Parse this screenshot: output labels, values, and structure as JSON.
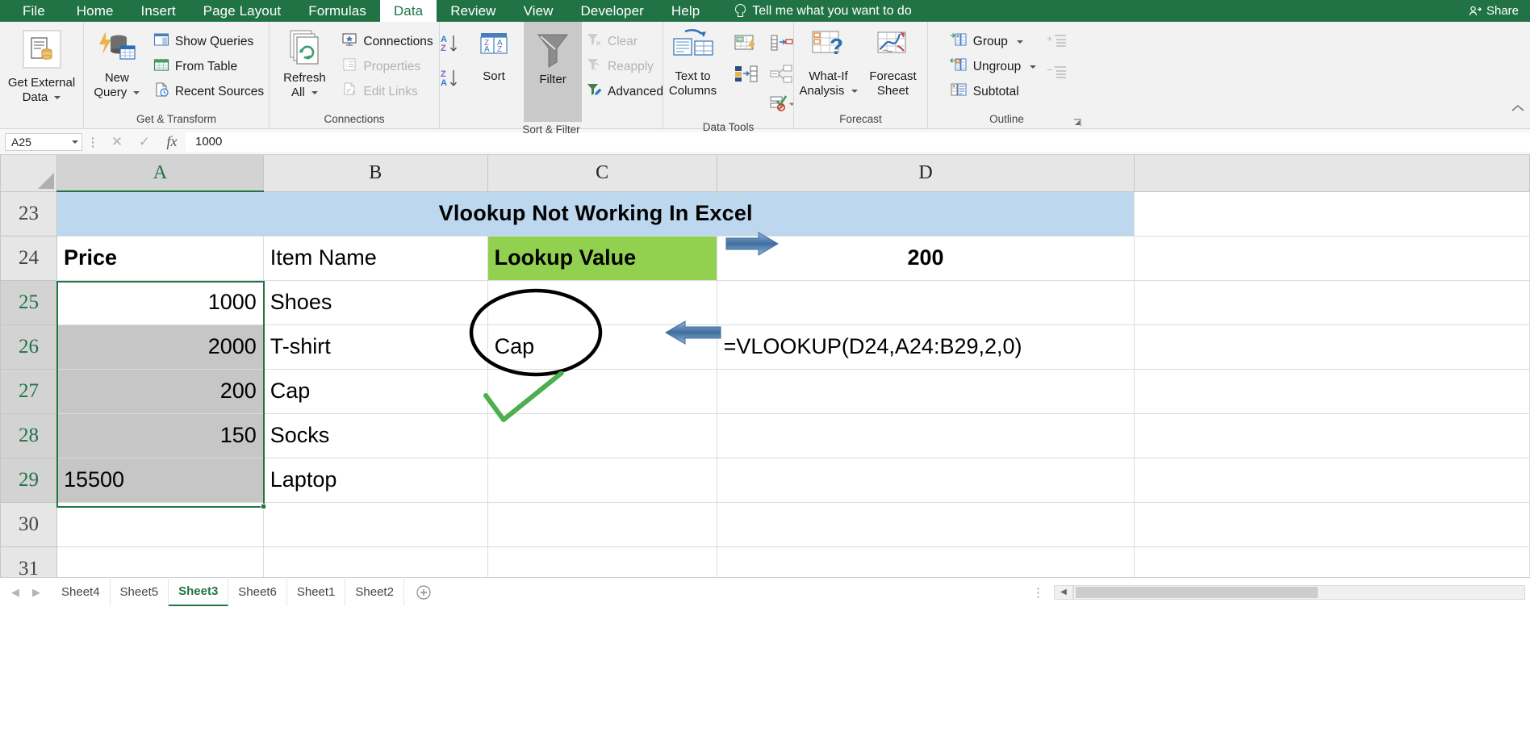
{
  "ribbon_tabs": [
    {
      "label": "File",
      "active": false
    },
    {
      "label": "Home",
      "active": false
    },
    {
      "label": "Insert",
      "active": false
    },
    {
      "label": "Page Layout",
      "active": false
    },
    {
      "label": "Formulas",
      "active": false
    },
    {
      "label": "Data",
      "active": true
    },
    {
      "label": "Review",
      "active": false
    },
    {
      "label": "View",
      "active": false
    },
    {
      "label": "Developer",
      "active": false
    },
    {
      "label": "Help",
      "active": false
    }
  ],
  "tellme": {
    "label": "Tell me what you want to do",
    "icon": "lightbulb-icon"
  },
  "share": {
    "label": "Share",
    "icon": "share-person-icon"
  },
  "ribbon_groups": [
    {
      "title": "",
      "big": [
        {
          "label_line1": "Get External",
          "label_line2": "Data",
          "icon": "get-external-data-icon",
          "dropdown": true
        }
      ]
    },
    {
      "title": "Get & Transform",
      "big": [
        {
          "label_line1": "New",
          "label_line2": "Query",
          "icon": "new-query-icon",
          "dropdown": true
        }
      ],
      "small": [
        {
          "label": "Show Queries",
          "icon": "show-queries-icon",
          "disabled": false
        },
        {
          "label": "From Table",
          "icon": "from-table-icon",
          "disabled": false
        },
        {
          "label": "Recent Sources",
          "icon": "recent-sources-icon",
          "disabled": false
        }
      ]
    },
    {
      "title": "Connections",
      "big": [
        {
          "label_line1": "Refresh",
          "label_line2": "All",
          "icon": "refresh-all-icon",
          "dropdown": true
        }
      ],
      "small": [
        {
          "label": "Connections",
          "icon": "connections-icon",
          "disabled": false
        },
        {
          "label": "Properties",
          "icon": "properties-icon",
          "disabled": true
        },
        {
          "label": "Edit Links",
          "icon": "edit-links-icon",
          "disabled": true
        }
      ]
    },
    {
      "title": "Sort & Filter",
      "small_left": [
        {
          "label": "",
          "icon": "sort-az-icon"
        },
        {
          "label": "",
          "icon": "sort-za-icon"
        }
      ],
      "big": [
        {
          "label_line1": "",
          "label_line2": "Sort",
          "icon": "sort-icon",
          "dropdown": false
        },
        {
          "label_line1": "",
          "label_line2": "Filter",
          "icon": "filter-icon",
          "dropdown": false,
          "active": true
        }
      ],
      "small": [
        {
          "label": "Clear",
          "icon": "clear-filter-icon",
          "disabled": true
        },
        {
          "label": "Reapply",
          "icon": "reapply-filter-icon",
          "disabled": true
        },
        {
          "label": "Advanced",
          "icon": "advanced-filter-icon",
          "disabled": false
        }
      ]
    },
    {
      "title": "Data Tools",
      "big": [
        {
          "label_line1": "Text to",
          "label_line2": "Columns",
          "icon": "text-to-columns-icon",
          "dropdown": false
        }
      ],
      "icons": [
        {
          "icon": "flash-fill-icon"
        },
        {
          "icon": "remove-duplicates-icon"
        },
        {
          "icon": "consolidate-icon"
        },
        {
          "icon": "relationships-icon"
        },
        {
          "icon": "data-validation-icon",
          "dropdown": true
        }
      ]
    },
    {
      "title": "Forecast",
      "big": [
        {
          "label_line1": "What-If",
          "label_line2": "Analysis",
          "icon": "what-if-analysis-icon",
          "dropdown": true
        },
        {
          "label_line1": "Forecast",
          "label_line2": "Sheet",
          "icon": "forecast-sheet-icon",
          "dropdown": false
        }
      ]
    },
    {
      "title": "Outline",
      "small": [
        {
          "label": "Group",
          "icon": "group-icon",
          "dropdown": true
        },
        {
          "label": "Ungroup",
          "icon": "ungroup-icon",
          "dropdown": true
        },
        {
          "label": "Subtotal",
          "icon": "subtotal-icon"
        }
      ],
      "icons2": [
        {
          "icon": "show-detail-icon"
        },
        {
          "icon": "hide-detail-icon"
        }
      ]
    }
  ],
  "formula_bar": {
    "name_box_value": "A25",
    "cancel_icon": "cancel-x-icon",
    "enter_icon": "enter-check-icon",
    "fx_icon": "insert-function-icon",
    "formula_value": "1000"
  },
  "sheet": {
    "column_headers": [
      "A",
      "B",
      "C",
      "D"
    ],
    "selected_column": "A",
    "row_headers": [
      "23",
      "24",
      "25",
      "26",
      "27",
      "28",
      "29",
      "30",
      "31"
    ],
    "selected_rows": [
      "25",
      "26",
      "27",
      "28",
      "29"
    ],
    "title_row": {
      "row": "23",
      "text": "Vlookup Not Working In Excel",
      "merged": "A:D",
      "bg": "#bdd7ee"
    },
    "header_row": {
      "row": "24",
      "a": "Price",
      "b": "Item Name",
      "c": "Lookup Value",
      "c_bg": "#92d050",
      "d": "200"
    },
    "data_rows": [
      {
        "row": "25",
        "price": "1000",
        "item": "Shoes",
        "c": "",
        "d": ""
      },
      {
        "row": "26",
        "price": "2000",
        "item": "T-shirt",
        "c": "Cap",
        "d": "=VLOOKUP(D24,A24:B29,2,0)"
      },
      {
        "row": "27",
        "price": "200",
        "item": "Cap",
        "c": "",
        "d": ""
      },
      {
        "row": "28",
        "price": "150",
        "item": "Socks",
        "c": "",
        "d": ""
      },
      {
        "row": "29",
        "price": "15500",
        "item": "Laptop",
        "c": "",
        "d": "",
        "price_align": "left"
      },
      {
        "row": "30",
        "price": "",
        "item": "",
        "c": "",
        "d": ""
      },
      {
        "row": "31",
        "price": "",
        "item": "",
        "c": "",
        "d": ""
      }
    ],
    "annotations": [
      {
        "name": "arrow-right-to-lookup-target",
        "type": "arrow",
        "direction": "right",
        "color": "#4a7ebb"
      },
      {
        "name": "arrow-left-to-formula",
        "type": "arrow",
        "direction": "left",
        "color": "#4a7ebb"
      },
      {
        "name": "circle-around-cap",
        "type": "ellipse",
        "color": "#000000"
      },
      {
        "name": "green-check-mark",
        "type": "check",
        "color": "#4caf50"
      }
    ]
  },
  "sheet_tabs": {
    "nav_prev": "◀",
    "nav_next": "▶",
    "tabs": [
      {
        "label": "Sheet4",
        "active": false
      },
      {
        "label": "Sheet5",
        "active": false
      },
      {
        "label": "Sheet3",
        "active": true
      },
      {
        "label": "Sheet6",
        "active": false
      },
      {
        "label": "Sheet1",
        "active": false
      },
      {
        "label": "Sheet2",
        "active": false
      }
    ],
    "add_sheet_icon": "add-sheet-plus-icon"
  }
}
